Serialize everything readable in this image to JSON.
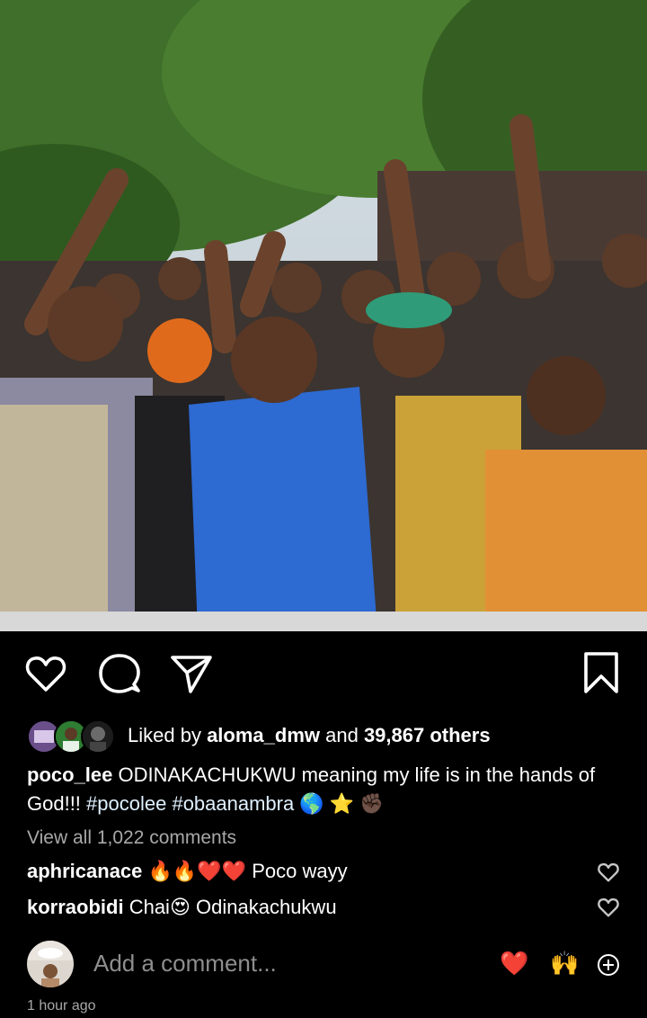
{
  "post": {
    "image_alt": "Crowd of young people cheering and pointing at the camera outdoors under trees"
  },
  "actions": {
    "like_icon": "heart-outline-icon",
    "comment_icon": "comment-bubble-icon",
    "share_icon": "paper-plane-icon",
    "save_icon": "bookmark-icon"
  },
  "likes": {
    "prefix": "Liked by ",
    "user": "aloma_dmw",
    "middle": " and ",
    "count": "39,867 others"
  },
  "caption": {
    "username": "poco_lee",
    "text": " ODINAKACHUKWU meaning my life is in the hands of God!!! ",
    "tags": "#pocolee #obaanambra",
    "emojis": "🌎 ⭐ ✊🏿"
  },
  "view_all": "View all 1,022 comments",
  "comments": [
    {
      "user": "aphricanace",
      "emojis": "🔥🔥❤️❤️",
      "text": "Poco wayy"
    },
    {
      "user": "korraobidi",
      "text_before": "Chai",
      "emojis": "😍",
      "text": "Odinakachukwu"
    }
  ],
  "add_comment": {
    "placeholder": "Add a comment...",
    "quick_reactions": [
      "❤️",
      "🙌"
    ]
  },
  "timestamp": "1 hour ago",
  "colors": {
    "background": "#000000",
    "muted": "#a8a8a8",
    "hashtag": "#e0f1ff"
  }
}
